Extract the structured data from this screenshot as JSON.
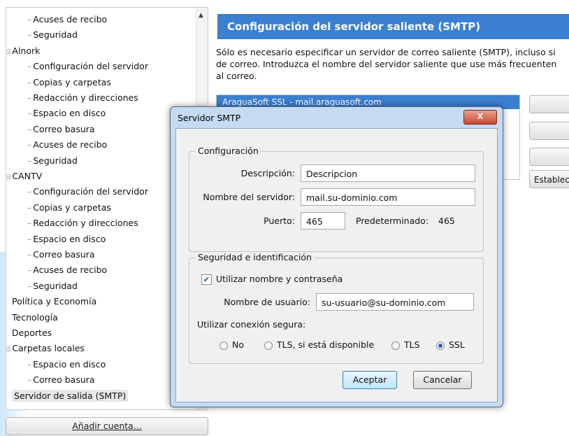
{
  "tree": {
    "items": [
      {
        "label": "Acuses de recibo",
        "level": 1
      },
      {
        "label": "Seguridad",
        "level": 1
      },
      {
        "label": "Alnork",
        "level": 0
      },
      {
        "label": "Configuración del servidor",
        "level": 1
      },
      {
        "label": "Copias y carpetas",
        "level": 1
      },
      {
        "label": "Redacción y direcciones",
        "level": 1
      },
      {
        "label": "Espacio en disco",
        "level": 1
      },
      {
        "label": "Correo basura",
        "level": 1
      },
      {
        "label": "Acuses de recibo",
        "level": 1
      },
      {
        "label": "Seguridad",
        "level": 1
      },
      {
        "label": "CANTV",
        "level": 0
      },
      {
        "label": "Configuración del servidor",
        "level": 1
      },
      {
        "label": "Copias y carpetas",
        "level": 1
      },
      {
        "label": "Redacción y direcciones",
        "level": 1
      },
      {
        "label": "Espacio en disco",
        "level": 1
      },
      {
        "label": "Correo basura",
        "level": 1
      },
      {
        "label": "Acuses de recibo",
        "level": 1
      },
      {
        "label": "Seguridad",
        "level": 1
      },
      {
        "label": "Política y Economía",
        "level": 0
      },
      {
        "label": "Tecnología",
        "level": 0
      },
      {
        "label": "Deportes",
        "level": 0
      },
      {
        "label": "Carpetas locales",
        "level": 0
      },
      {
        "label": "Espacio en disco",
        "level": 1
      },
      {
        "label": "Correo basura",
        "level": 1
      },
      {
        "label": "Servidor de salida (SMTP)",
        "level": 0,
        "selected": true
      }
    ],
    "add_account_label": "Añadir cuenta..."
  },
  "main": {
    "header": "Configuración del servidor saliente (SMTP)",
    "description_lines": [
      "Sólo es necesario especificar un servidor de correo saliente (SMTP), incluso si",
      "de correo. Introduzca el nombre del servidor saliente que use más frecuenten",
      "al correo."
    ],
    "server_list": [
      "AraguaSoft SSL - mail.araguasoft.com"
    ],
    "right_buttons": [
      "",
      "",
      "",
      "Establec"
    ]
  },
  "dialog": {
    "title": "Servidor SMTP",
    "close_glyph": "X",
    "config_group_title": "Configuración",
    "description_label": "Descripción:",
    "description_value": "Descripcion",
    "server_label": "Nombre del servidor:",
    "server_value": "mail.su-dominio.com",
    "port_label": "Puerto:",
    "port_value": "465",
    "default_label": "Predeterminado:",
    "default_value": "465",
    "security_group_title": "Seguridad e identificación",
    "use_credentials_label": "Utilizar nombre y contraseña",
    "use_credentials_checked": true,
    "username_label": "Nombre de usuario:",
    "username_value": "su-usuario@su-dominio.com",
    "secure_conn_label": "Utilizar conexión segura:",
    "secure_options": [
      {
        "label": "No",
        "selected": false
      },
      {
        "label": "TLS, si está disponible",
        "selected": false
      },
      {
        "label": "TLS",
        "selected": false
      },
      {
        "label": "SSL",
        "selected": true
      }
    ],
    "ok_label": "Aceptar",
    "cancel_label": "Cancelar"
  }
}
